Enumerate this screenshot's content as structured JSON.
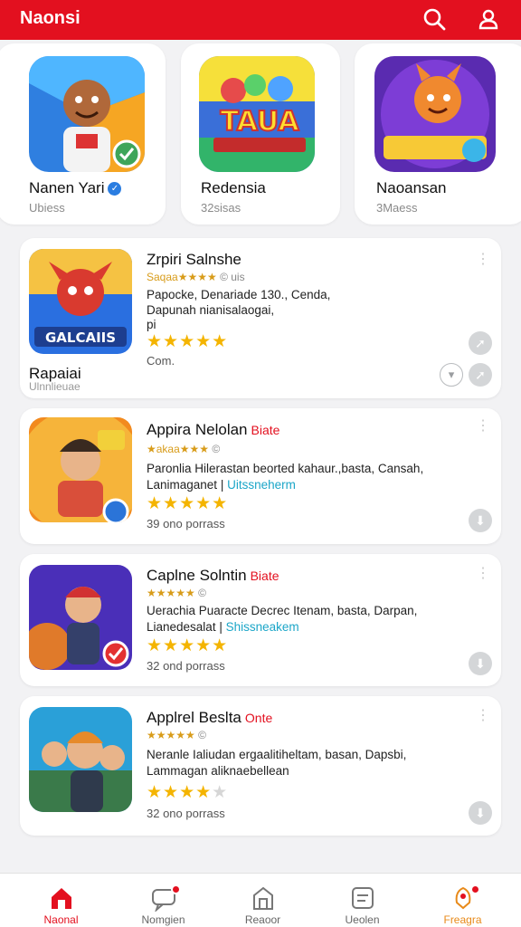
{
  "app": {
    "title": "Naonsi"
  },
  "header": {
    "icons": [
      "search-icon",
      "user-icon"
    ]
  },
  "colors": {
    "brand": "#e3101f",
    "star": "#f4b400",
    "link": "#1ba6c8"
  },
  "featured": [
    {
      "name": "Nanen Yari",
      "sub": "Ubiess",
      "verified": true
    },
    {
      "name": "Redensia",
      "sub": "32sisas"
    },
    {
      "name": "Naoansan",
      "sub": "3Maess"
    }
  ],
  "list": [
    {
      "title": "Zrpiri Salnshe",
      "tag": "",
      "subtitle": "Saqaa★★★★",
      "subtitle_muted": "© uis",
      "desc1": "Papocke, Denariade 130., Cenda,",
      "desc1_link": "",
      "desc2": "Dapunah nianisalaogai,",
      "desc3": "pi",
      "stars": 5,
      "meta": "Com.",
      "footer": "Rapaiai",
      "footer2": "Ulnnlieuae"
    },
    {
      "title": "Appira Nelolan",
      "tag": "Biate",
      "subtitle": "★akaa★★★",
      "subtitle_muted": "©",
      "desc1": "Paronlia Hilerastan beorted kahaur.,basta, Cansah,",
      "desc2": "Lanimaganet",
      "desc2_link": "Uitssneherm",
      "stars": 5,
      "meta": "39 ono porrass"
    },
    {
      "title": "Caplne Solntin",
      "tag": "Biate",
      "subtitle": "★★★★★",
      "subtitle_muted": "©",
      "desc1": "Uerachia Puaracte Decrec Itenam, basta, Darpan,",
      "desc2": "Lianedesalat",
      "desc2_link": "Shissneakem",
      "stars": 5,
      "meta": "32 ond porrass"
    },
    {
      "title": "Applrel Beslta",
      "tag": "Onte",
      "subtitle": "★★★★★",
      "subtitle_muted": "©",
      "desc1": "Neranle Ialiudan ergaalitiheltam, basan, Dapsbi,",
      "desc2": "Lammagan aliknaebellean",
      "desc2_link": "",
      "stars": 4,
      "meta": "32 ono porrass"
    }
  ],
  "nav": [
    {
      "label": "Naonal",
      "icon": "home-icon",
      "active": true
    },
    {
      "label": "Nomgien",
      "icon": "chat-icon",
      "badge": true
    },
    {
      "label": "Reaoor",
      "icon": "store-icon"
    },
    {
      "label": "Ueolen",
      "icon": "message-icon"
    },
    {
      "label": "Freagra",
      "icon": "rocket-icon",
      "badge": true
    }
  ]
}
